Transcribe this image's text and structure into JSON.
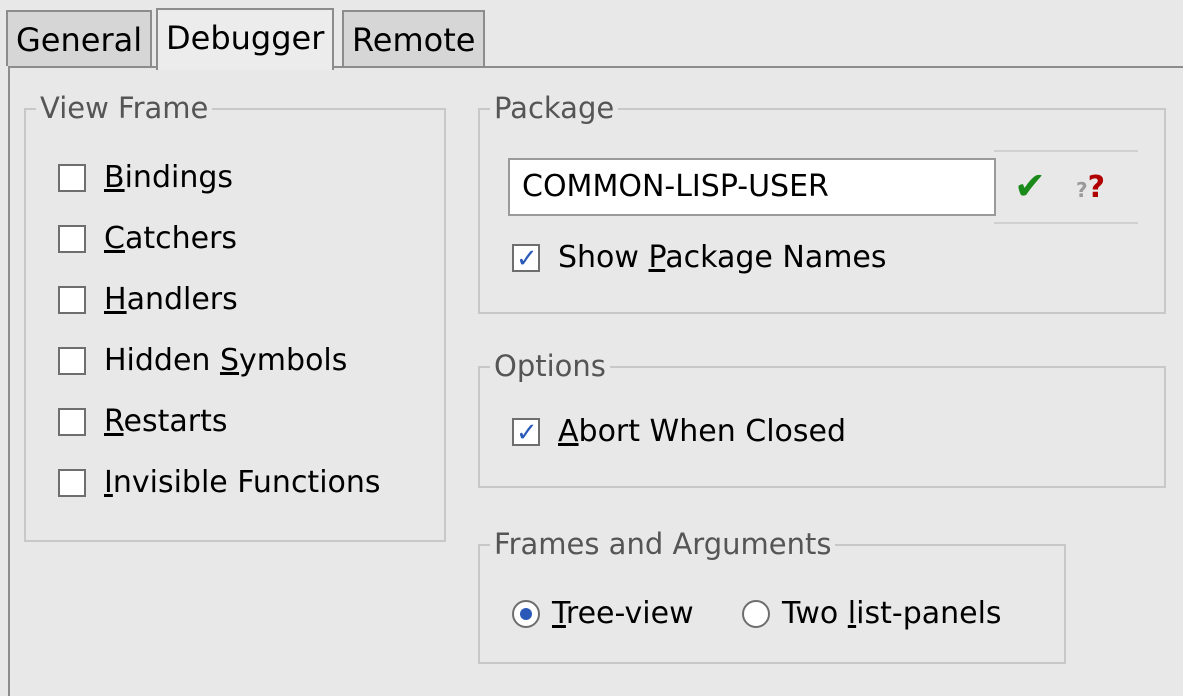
{
  "tabs": [
    {
      "label": "General"
    },
    {
      "label": "Debugger"
    },
    {
      "label": "Remote"
    }
  ],
  "view_frame": {
    "title": "View Frame",
    "items": [
      {
        "pre": "",
        "mn": "B",
        "post": "indings",
        "checked": false
      },
      {
        "pre": "",
        "mn": "C",
        "post": "atchers",
        "checked": false
      },
      {
        "pre": "",
        "mn": "H",
        "post": "andlers",
        "checked": false
      },
      {
        "pre": "Hidden ",
        "mn": "S",
        "post": "ymbols",
        "checked": false
      },
      {
        "pre": "",
        "mn": "R",
        "post": "estarts",
        "checked": false
      },
      {
        "pre": "",
        "mn": "I",
        "post": "nvisible Functions",
        "checked": false
      }
    ]
  },
  "package": {
    "title": "Package",
    "value": "COMMON-LISP-USER",
    "apply_icon": "checkmark-icon",
    "help_icon": "question-help-icon",
    "show_names": {
      "pre": "Show ",
      "mn": "P",
      "post": "ackage Names",
      "checked": true
    }
  },
  "options": {
    "title": "Options",
    "abort": {
      "pre": "",
      "mn": "A",
      "post": "bort When Closed",
      "checked": true
    }
  },
  "frames": {
    "title": "Frames and Arguments",
    "tree": {
      "pre": "",
      "mn": "T",
      "post": "ree-view",
      "selected": true
    },
    "two": {
      "pre": "Two ",
      "mn": "l",
      "post": "ist-panels",
      "selected": false
    }
  },
  "colors": {
    "accent": "#2a59b8",
    "check": "#1a8a1a",
    "help": "#b00000"
  }
}
